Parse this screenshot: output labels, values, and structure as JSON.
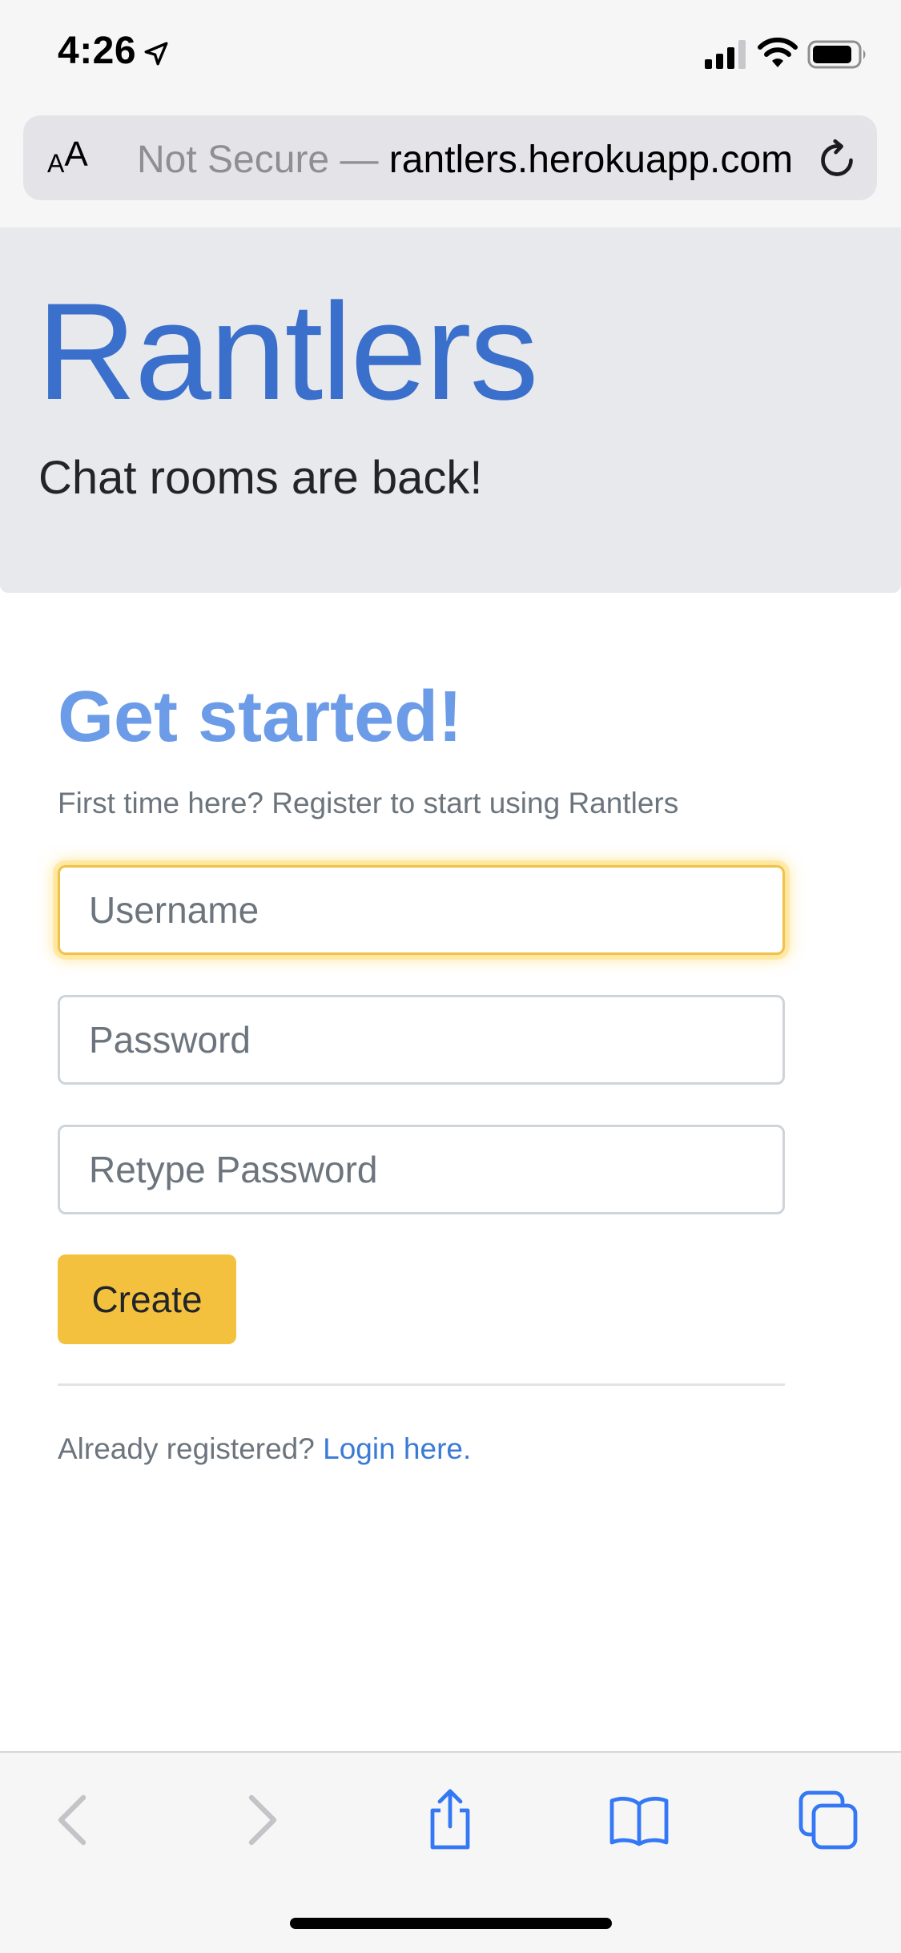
{
  "status_bar": {
    "time": "4:26"
  },
  "browser": {
    "text_size_small": "A",
    "text_size_large": "A",
    "url_security": "Not Secure —",
    "url_domain": "rantlers.herokuapp.com"
  },
  "jumbotron": {
    "title": "Rantlers",
    "tagline": "Chat rooms are back!"
  },
  "register": {
    "heading": "Get started!",
    "subtitle": "First time here? Register to start using Rantlers",
    "username_placeholder": "Username",
    "password_placeholder": "Password",
    "retype_password_placeholder": "Retype Password",
    "create_label": "Create",
    "already_registered": "Already registered?",
    "login_link": "Login here."
  },
  "icons": {
    "location": "location-arrow-icon",
    "signal": "cellular-signal-icon",
    "wifi": "wifi-icon",
    "battery": "battery-icon",
    "reload": "reload-icon",
    "back": "chevron-left-icon",
    "forward": "chevron-right-icon",
    "share": "share-icon",
    "bookmarks": "book-icon",
    "tabs": "tabs-icon"
  },
  "colors": {
    "brand_blue": "#3a6fcb",
    "heading_blue": "#6c9ce8",
    "button_yellow": "#f4c13f",
    "focus_glow": "#ffd65a",
    "link_blue": "#3a7bd5",
    "ios_blue": "#3478f6"
  }
}
